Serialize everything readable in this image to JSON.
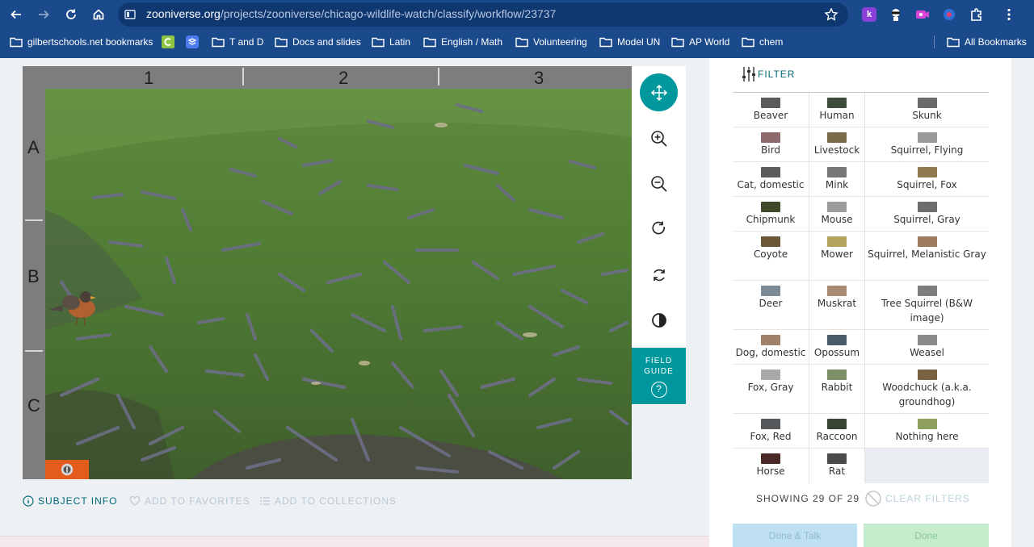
{
  "browser": {
    "url_host": "zooniverse.org",
    "url_path": "/projects/zooniverse/chicago-wildlife-watch/classify/workflow/23737",
    "extensions": [
      {
        "icon": "k-extension-icon",
        "label": "k",
        "color": "#8a3fd6"
      },
      {
        "icon": "ninja-extension-icon",
        "label": "",
        "color": "#1b4a8c"
      },
      {
        "icon": "video-extension-icon",
        "label": "",
        "color": "#c93bd6"
      },
      {
        "icon": "record-extension-icon",
        "label": "",
        "color": "#1b4a8c"
      }
    ],
    "bookmarks": [
      {
        "label": "gilbertschools.net bookmarks",
        "icon": "folder-icon"
      },
      {
        "label": "",
        "icon": "c-extension-icon"
      },
      {
        "label": "",
        "icon": "stack-extension-icon"
      },
      {
        "label": "T and D",
        "icon": "folder-icon"
      },
      {
        "label": "Docs and slides",
        "icon": "folder-icon"
      },
      {
        "label": "Latin",
        "icon": "folder-icon"
      },
      {
        "label": "English / Math",
        "icon": "folder-icon"
      },
      {
        "label": "Volunteering",
        "icon": "folder-icon"
      },
      {
        "label": "Model UN",
        "icon": "folder-icon"
      },
      {
        "label": "AP World",
        "icon": "folder-icon"
      },
      {
        "label": "chem",
        "icon": "folder-icon"
      }
    ],
    "all_bookmarks": "All Bookmarks"
  },
  "viewer": {
    "columns": [
      "1",
      "2",
      "3"
    ],
    "rows": [
      "A",
      "B",
      "C"
    ],
    "tools": [
      {
        "name": "move-icon",
        "active": true
      },
      {
        "name": "zoom-in-icon",
        "active": false
      },
      {
        "name": "zoom-out-icon",
        "active": false
      },
      {
        "name": "rotate-icon",
        "active": false
      },
      {
        "name": "reset-icon",
        "active": false
      },
      {
        "name": "invert-icon",
        "active": false
      }
    ],
    "field_guide_line1": "FIELD",
    "field_guide_line2": "GUIDE",
    "field_guide_icon": "?"
  },
  "subject_links": {
    "subject_info": "SUBJECT INFO",
    "add_favorites": "ADD TO FAVORITES",
    "add_collections": "ADD TO COLLECTIONS"
  },
  "task": {
    "filter_label": "FILTER",
    "rows": [
      [
        {
          "label": "Beaver",
          "thumb": "#5b5b5b"
        },
        {
          "label": "Human",
          "thumb": "#3d4d3a"
        },
        {
          "label": "Skunk",
          "thumb": "#6a6a6a"
        }
      ],
      [
        {
          "label": "Bird",
          "thumb": "#8e6a6e"
        },
        {
          "label": "Livestock",
          "thumb": "#7a6a4a"
        },
        {
          "label": "Squirrel, Flying",
          "thumb": "#9a9a9a"
        }
      ],
      [
        {
          "label": "Cat, domestic",
          "thumb": "#5c5c5c"
        },
        {
          "label": "Mink",
          "thumb": "#777777"
        },
        {
          "label": "Squirrel, Fox",
          "thumb": "#8f7a52"
        }
      ],
      [
        {
          "label": "Chipmunk",
          "thumb": "#3e4a2a"
        },
        {
          "label": "Mouse",
          "thumb": "#9c9c9c"
        },
        {
          "label": "Squirrel, Gray",
          "thumb": "#6d6d6d"
        }
      ],
      [
        {
          "label": "Coyote",
          "thumb": "#6b5838"
        },
        {
          "label": "Mower",
          "thumb": "#b2a45c"
        },
        {
          "label": "Squirrel, Melanistic Gray",
          "thumb": "#9e7b5c"
        }
      ],
      [
        {
          "label": "Deer",
          "thumb": "#7c8a96"
        },
        {
          "label": "Muskrat",
          "thumb": "#a88a70"
        },
        {
          "label": "Tree Squirrel (B&W image)",
          "thumb": "#7d7d7d"
        }
      ],
      [
        {
          "label": "Dog, domestic",
          "thumb": "#a0826a"
        },
        {
          "label": "Opossum",
          "thumb": "#4a5a66"
        },
        {
          "label": "Weasel",
          "thumb": "#8a8a8a"
        }
      ],
      [
        {
          "label": "Fox, Gray",
          "thumb": "#a9a9a9"
        },
        {
          "label": "Rabbit",
          "thumb": "#7d8f66"
        },
        {
          "label": "Woodchuck (a.k.a. groundhog)",
          "thumb": "#7a6340"
        }
      ],
      [
        {
          "label": "Fox, Red",
          "thumb": "#55595c"
        },
        {
          "label": "Raccoon",
          "thumb": "#3a4432"
        },
        {
          "label": "Nothing here",
          "thumb": "#8ea05c"
        }
      ],
      [
        {
          "label": "Horse",
          "thumb": "#4a2a26"
        },
        {
          "label": "Rat",
          "thumb": "#4a4a4a"
        },
        {
          "label": "",
          "thumb": ""
        }
      ]
    ],
    "showing": "SHOWING 29 OF 29",
    "clear_filters": "CLEAR FILTERS",
    "done_talk": "Done & Talk",
    "done": "Done"
  },
  "colors": {
    "chrome": "#1b4a8c",
    "accent": "#00979d",
    "link": "#00687a"
  }
}
